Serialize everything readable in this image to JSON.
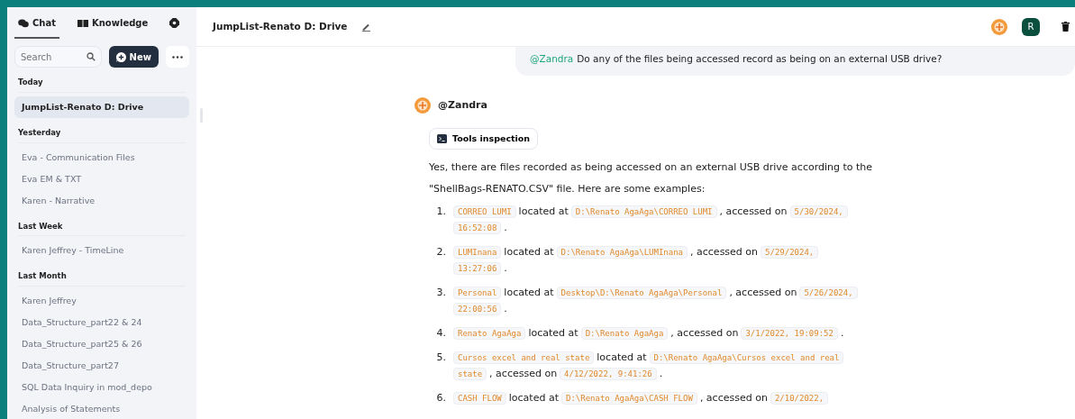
{
  "sidebar": {
    "tabs": [
      {
        "label": "Chat",
        "selected": true
      },
      {
        "label": "Knowledge",
        "selected": false
      }
    ],
    "search": {
      "placeholder": "Search"
    },
    "new_button": "New",
    "groups": [
      {
        "heading": "Today",
        "items": [
          {
            "label": "JumpList-Renato D: Drive",
            "selected": true
          }
        ]
      },
      {
        "heading": "Yesterday",
        "items": [
          {
            "label": "Eva - Communication Files",
            "selected": false
          },
          {
            "label": "Eva EM & TXT",
            "selected": false
          },
          {
            "label": "Karen - Narrative",
            "selected": false
          }
        ]
      },
      {
        "heading": "Last Week",
        "items": [
          {
            "label": "Karen Jeffrey - TimeLine",
            "selected": false
          }
        ]
      },
      {
        "heading": "Last Month",
        "items": [
          {
            "label": "Karen Jeffrey",
            "selected": false
          },
          {
            "label": "Data_Structure_part22 & 24",
            "selected": false
          },
          {
            "label": "Data_Structure_part25 & 26",
            "selected": false
          },
          {
            "label": "Data_Structure_part27",
            "selected": false
          },
          {
            "label": "SQL Data Inquiry in mod_depo",
            "selected": false
          },
          {
            "label": "Analysis of  Statements",
            "selected": false
          }
        ]
      }
    ]
  },
  "header": {
    "title": "JumpList-Renato D: Drive",
    "user_initial": "R"
  },
  "messages": [
    {
      "kind": "user",
      "mention": "@Zandra",
      "text": "Do any of the files being accessed record as being on an external USB drive?"
    },
    {
      "kind": "assistant",
      "author": "@Zandra",
      "tool": "Tools inspection",
      "intro": "Yes, there are files recorded as being accessed on an external USB drive according to the \"ShellBags-RENATO.CSV\" file. Here are some examples:",
      "items": [
        {
          "number": "1.",
          "parts": [
            {
              "kind": "code",
              "text": "CORREO LUMI"
            },
            {
              "kind": "text",
              "text": "located at"
            },
            {
              "kind": "code",
              "text": "D:\\Renato AgaAga\\CORREO LUMI"
            },
            {
              "kind": "text",
              "text": ", accessed on"
            },
            {
              "kind": "code",
              "text": "5/30/2024, 16:52:08"
            },
            {
              "kind": "text",
              "text": "."
            }
          ]
        },
        {
          "number": "2.",
          "parts": [
            {
              "kind": "code",
              "text": "LUMInana"
            },
            {
              "kind": "text",
              "text": "located at"
            },
            {
              "kind": "code",
              "text": "D:\\Renato AgaAga\\LUMInana"
            },
            {
              "kind": "text",
              "text": ", accessed on"
            },
            {
              "kind": "code",
              "text": "5/29/2024, 13:27:06"
            },
            {
              "kind": "text",
              "text": "."
            }
          ]
        },
        {
          "number": "3.",
          "parts": [
            {
              "kind": "code",
              "text": "Personal"
            },
            {
              "kind": "text",
              "text": "located at"
            },
            {
              "kind": "code",
              "text": "Desktop\\D:\\Renato AgaAga\\Personal"
            },
            {
              "kind": "text",
              "text": ", accessed on"
            },
            {
              "kind": "code",
              "text": "5/26/2024, 22:00:56"
            },
            {
              "kind": "text",
              "text": "."
            }
          ]
        },
        {
          "number": "4.",
          "parts": [
            {
              "kind": "code",
              "text": "Renato AgaAga"
            },
            {
              "kind": "text",
              "text": "located at"
            },
            {
              "kind": "code",
              "text": "D:\\Renato AgaAga"
            },
            {
              "kind": "text",
              "text": ", accessed on"
            },
            {
              "kind": "code",
              "text": "3/1/2022, 19:09:52"
            },
            {
              "kind": "text",
              "text": "."
            }
          ]
        },
        {
          "number": "5.",
          "parts": [
            {
              "kind": "code",
              "text": "Cursos excel and real state"
            },
            {
              "kind": "text",
              "text": "located at"
            },
            {
              "kind": "code",
              "text": "D:\\Renato AgaAga\\Cursos excel and real state"
            },
            {
              "kind": "text",
              "text": ", accessed on"
            },
            {
              "kind": "code",
              "text": "4/12/2022, 9:41:26"
            },
            {
              "kind": "text",
              "text": "."
            }
          ]
        },
        {
          "number": "6.",
          "parts": [
            {
              "kind": "code",
              "text": "CASH FLOW"
            },
            {
              "kind": "text",
              "text": "located at"
            },
            {
              "kind": "code",
              "text": "D:\\Renato AgaAga\\CASH FLOW"
            },
            {
              "kind": "text",
              "text": ", accessed on"
            },
            {
              "kind": "code",
              "text": "2/10/2022,"
            }
          ]
        }
      ]
    }
  ]
}
